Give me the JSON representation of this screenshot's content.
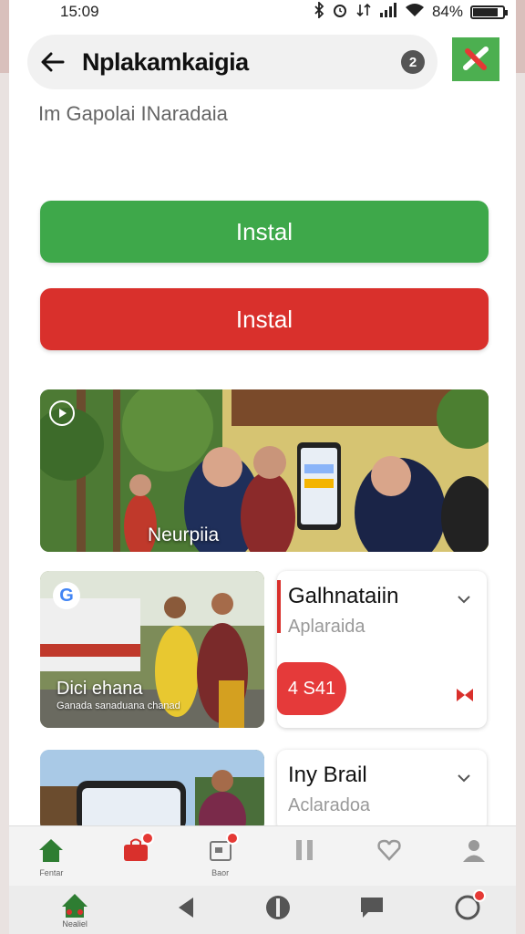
{
  "status_bar": {
    "time": "15:09",
    "battery": "84%"
  },
  "app_bar": {
    "title": "Nplakamkaigia",
    "help_glyph": "2"
  },
  "subtitle": "Im Gapolai INaradaia",
  "buttons": {
    "install_green": "Instal",
    "install_red": "Instal"
  },
  "hero": {
    "caption": "Neurpiia"
  },
  "cards": [
    {
      "image_caption": "Dici ehana",
      "image_sub": "Ganada sanaduana chanad",
      "title": "Galhnataiin",
      "subtitle": "Aplaraida",
      "price": "4 S41"
    },
    {
      "title": "Iny Brail",
      "subtitle": "Aclaradoa"
    }
  ],
  "bottom_nav": [
    {
      "icon": "home-icon",
      "label": "Fentar"
    },
    {
      "icon": "shop-bag-icon",
      "label": ""
    },
    {
      "icon": "calendar-icon",
      "label": "Baor"
    },
    {
      "icon": "pause-icon",
      "label": ""
    },
    {
      "icon": "heart-icon",
      "label": ""
    },
    {
      "icon": "profile-icon",
      "label": ""
    }
  ],
  "system_nav": {
    "app_label": "Nealiel"
  },
  "colors": {
    "green": "#3ea84a",
    "red": "#d9302c",
    "home_green": "#2e7d32"
  }
}
